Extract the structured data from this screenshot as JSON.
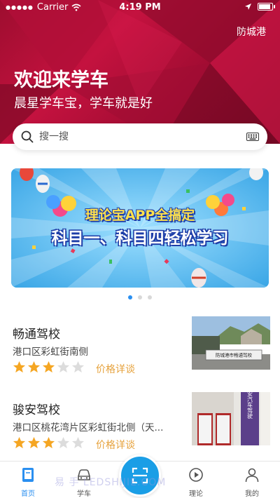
{
  "status_bar": {
    "carrier": "Carrier",
    "time": "4:19 PM"
  },
  "header": {
    "city": "防城港",
    "welcome": "欢迎来学车",
    "slogan": "晨星学车宝，学车就是好",
    "accent_color": "#c4123f"
  },
  "search": {
    "placeholder": "搜一搜"
  },
  "banner": {
    "title": "理论宝APP全搞定",
    "subtitle": "科目一、科目四轻松学习",
    "page_count": 3,
    "active_page": 1
  },
  "schools": [
    {
      "name": "畅通驾校",
      "address": "港口区彩虹街南侧",
      "rating": 3,
      "max_rating": 5,
      "price_link": "价格详谈",
      "sign_text": "防城港市畅通驾校"
    },
    {
      "name": "骏安驾校",
      "address": "港口区桃花湾片区彩虹街北侧（天...",
      "rating": 3,
      "max_rating": 5,
      "price_link": "价格详谈",
      "sign_text": "骏安汽车驾驶"
    }
  ],
  "tabbar": {
    "tabs": [
      {
        "label": "首页",
        "icon": "home-book-icon",
        "active": true
      },
      {
        "label": "学车",
        "icon": "car-icon",
        "active": false
      },
      {
        "label": "",
        "icon": "scan-icon",
        "active": false
      },
      {
        "label": "理论",
        "icon": "play-video-icon",
        "active": false
      },
      {
        "label": "我的",
        "icon": "user-icon",
        "active": false
      }
    ],
    "active_color": "#2a8ff0",
    "scan_color": "#1a9ee6"
  },
  "watermark": "易 手 LEDSHIJIE.COM"
}
